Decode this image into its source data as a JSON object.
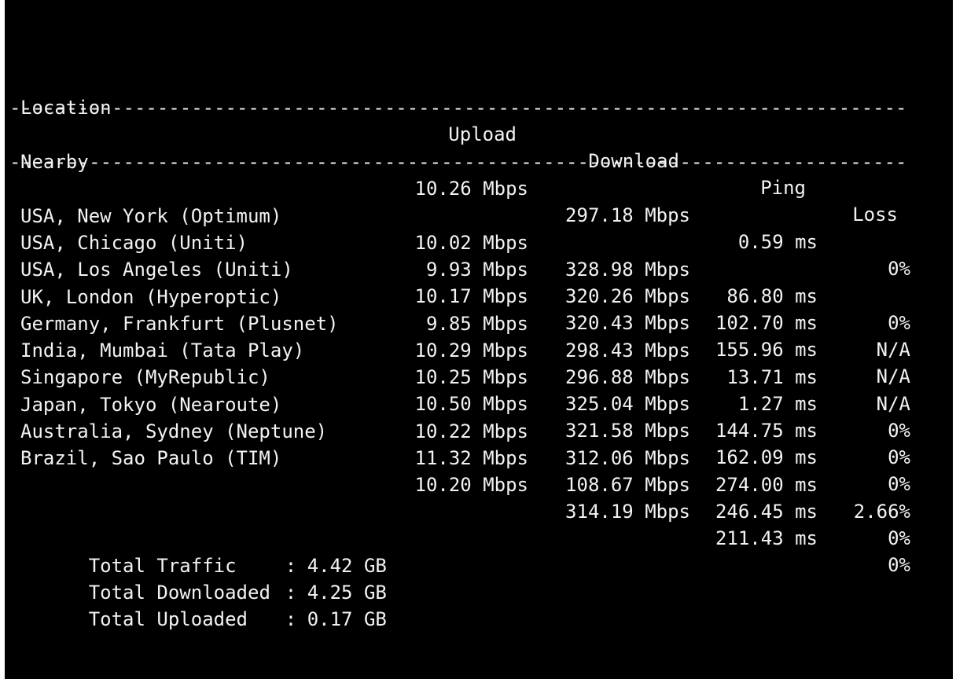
{
  "header": {
    "location": "Location",
    "upload": "Upload",
    "download": "Download",
    "ping": "Ping",
    "loss": "Loss"
  },
  "separator": "-------------------------------------------------------------------------------",
  "nearby": {
    "location": "Nearby",
    "upload": "10.26 Mbps",
    "download": "297.18 Mbps",
    "ping": "0.59 ms",
    "loss": "0%"
  },
  "rows": [
    {
      "location": "USA, New York (Optimum)",
      "upload": "10.02 Mbps",
      "download": "328.98 Mbps",
      "ping": "86.80 ms",
      "loss": "0%"
    },
    {
      "location": "USA, Chicago (Uniti)",
      "upload": "9.93 Mbps",
      "download": "320.26 Mbps",
      "ping": "102.70 ms",
      "loss": "N/A"
    },
    {
      "location": "USA, Los Angeles (Uniti)",
      "upload": "10.17 Mbps",
      "download": "320.43 Mbps",
      "ping": "155.96 ms",
      "loss": "N/A"
    },
    {
      "location": "UK, London (Hyperoptic)",
      "upload": "9.85 Mbps",
      "download": "298.43 Mbps",
      "ping": "13.71 ms",
      "loss": "N/A"
    },
    {
      "location": "Germany, Frankfurt (Plusnet)",
      "upload": "10.29 Mbps",
      "download": "296.88 Mbps",
      "ping": "1.27 ms",
      "loss": "0%"
    },
    {
      "location": "India, Mumbai (Tata Play)",
      "upload": "10.25 Mbps",
      "download": "325.04 Mbps",
      "ping": "144.75 ms",
      "loss": "0%"
    },
    {
      "location": "Singapore (MyRepublic)",
      "upload": "10.50 Mbps",
      "download": "321.58 Mbps",
      "ping": "162.09 ms",
      "loss": "0%"
    },
    {
      "location": "Japan, Tokyo (Nearoute)",
      "upload": "10.22 Mbps",
      "download": "312.06 Mbps",
      "ping": "274.00 ms",
      "loss": "2.66%"
    },
    {
      "location": "Australia, Sydney (Neptune)",
      "upload": "11.32 Mbps",
      "download": "108.67 Mbps",
      "ping": "246.45 ms",
      "loss": "0%"
    },
    {
      "location": "Brazil, Sao Paulo (TIM)",
      "upload": "10.20 Mbps",
      "download": "314.19 Mbps",
      "ping": "211.43 ms",
      "loss": "0%"
    }
  ],
  "summary": [
    {
      "label": "Total Traffic",
      "colon": ":",
      "value": "4.42 GB"
    },
    {
      "label": "Total Downloaded",
      "colon": ":",
      "value": "4.25 GB"
    },
    {
      "label": "Total Uploaded",
      "colon": ":",
      "value": "0.17 GB"
    }
  ],
  "colors": {
    "background": "#000000",
    "text": "#f2f2f2"
  }
}
